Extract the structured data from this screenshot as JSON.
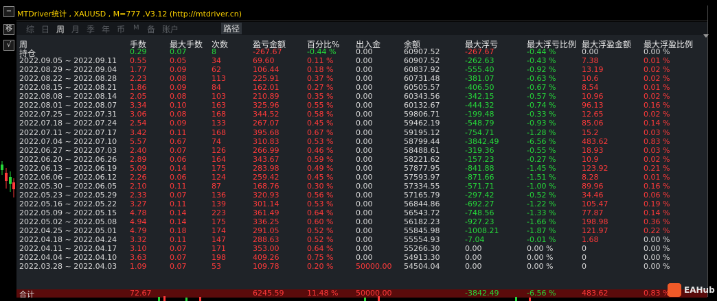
{
  "window": {
    "title": "MTDriver统计 , XAUUSD , M=777 ,V3.12 (http://mtdriver.cn)",
    "minimize_label": "−",
    "move_label": "移",
    "check_label": "√"
  },
  "tabs": [
    {
      "label": "综",
      "active": false
    },
    {
      "label": "日",
      "active": false
    },
    {
      "label": "周",
      "active": true
    },
    {
      "label": "月",
      "active": false
    },
    {
      "label": "季",
      "active": false
    },
    {
      "label": "年",
      "active": false
    },
    {
      "label": "币",
      "active": false
    },
    {
      "label": "M",
      "active": false
    },
    {
      "label": "备",
      "active": false
    },
    {
      "label": "账户",
      "active": false
    },
    {
      "label": "路径",
      "active": false
    }
  ],
  "table": {
    "headers": [
      "周",
      "手数",
      "最大手数",
      "次数",
      "盈亏金额",
      "百分比%",
      "出入金",
      "余额",
      "最大浮亏",
      "最大浮亏比例",
      "最大浮盈金额",
      "最大浮盈比例"
    ],
    "holding": [
      "持仓",
      "0.29",
      "0.07",
      "8",
      "-267.67",
      "-0.44 %",
      "0.00",
      "60907.52",
      "-267.67",
      "-0.44 %",
      "0.00",
      "0.00 %"
    ],
    "rows": [
      [
        "2022.09.05 ~ 2022.09.11",
        "0.55",
        "0.05",
        "34",
        "69.60",
        "0.11 %",
        "0.00",
        "60907.52",
        "-262.63",
        "-0.43 %",
        "7.38",
        "0.01 %"
      ],
      [
        "2022.08.29 ~ 2022.09.04",
        "1.77",
        "0.09",
        "62",
        "106.44",
        "0.18 %",
        "0.00",
        "60837.92",
        "-555.40",
        "-0.92 %",
        "13.19",
        "0.02 %"
      ],
      [
        "2022.08.22 ~ 2022.08.28",
        "2.23",
        "0.08",
        "113",
        "225.91",
        "0.37 %",
        "0.00",
        "60731.48",
        "-381.07",
        "-0.63 %",
        "10.6",
        "0.02 %"
      ],
      [
        "2022.08.15 ~ 2022.08.21",
        "1.86",
        "0.09",
        "84",
        "162.01",
        "0.27 %",
        "0.00",
        "60505.57",
        "-406.50",
        "-0.67 %",
        "8.54",
        "0.01 %"
      ],
      [
        "2022.08.08 ~ 2022.08.14",
        "2.05",
        "0.08",
        "103",
        "210.89",
        "0.35 %",
        "0.00",
        "60343.56",
        "-342.15",
        "-0.57 %",
        "10.96",
        "0.02 %"
      ],
      [
        "2022.08.01 ~ 2022.08.07",
        "3.34",
        "0.10",
        "163",
        "325.96",
        "0.55 %",
        "0.00",
        "60132.67",
        "-444.32",
        "-0.74 %",
        "96.13",
        "0.16 %"
      ],
      [
        "2022.07.25 ~ 2022.07.31",
        "3.06",
        "0.08",
        "168",
        "344.52",
        "0.58 %",
        "0.00",
        "59806.71",
        "-199.48",
        "-0.33 %",
        "12.65",
        "0.02 %"
      ],
      [
        "2022.07.18 ~ 2022.07.24",
        "2.54",
        "0.09",
        "133",
        "267.07",
        "0.45 %",
        "0.00",
        "59462.19",
        "-548.79",
        "-0.93 %",
        "85.06",
        "0.14 %"
      ],
      [
        "2022.07.11 ~ 2022.07.17",
        "3.42",
        "0.11",
        "168",
        "395.68",
        "0.67 %",
        "0.00",
        "59195.12",
        "-754.71",
        "-1.28 %",
        "15.2",
        "0.03 %"
      ],
      [
        "2022.07.04 ~ 2022.07.10",
        "5.57",
        "0.67",
        "74",
        "310.83",
        "0.53 %",
        "0.00",
        "58799.44",
        "-3842.49",
        "-6.56 %",
        "483.62",
        "0.83 %"
      ],
      [
        "2022.06.27 ~ 2022.07.03",
        "2.40",
        "0.07",
        "126",
        "266.99",
        "0.46 %",
        "0.00",
        "58488.61",
        "-319.36",
        "-0.55 %",
        "18.93",
        "0.03 %"
      ],
      [
        "2022.06.20 ~ 2022.06.26",
        "2.89",
        "0.06",
        "164",
        "343.67",
        "0.59 %",
        "0.00",
        "58221.62",
        "-157.23",
        "-0.27 %",
        "10.9",
        "0.02 %"
      ],
      [
        "2022.06.13 ~ 2022.06.19",
        "5.09",
        "0.14",
        "175",
        "283.98",
        "0.49 %",
        "0.00",
        "57877.95",
        "-841.88",
        "-1.45 %",
        "123.92",
        "0.21 %"
      ],
      [
        "2022.06.06 ~ 2022.06.12",
        "2.26",
        "0.06",
        "124",
        "259.42",
        "0.45 %",
        "0.00",
        "57593.97",
        "-871.66",
        "-1.51 %",
        "8.28",
        "0.01 %"
      ],
      [
        "2022.05.30 ~ 2022.06.05",
        "2.10",
        "0.11",
        "87",
        "168.76",
        "0.30 %",
        "0.00",
        "57334.55",
        "-571.71",
        "-1.00 %",
        "89.96",
        "0.16 %"
      ],
      [
        "2022.05.23 ~ 2022.05.29",
        "2.33",
        "0.07",
        "136",
        "320.93",
        "0.56 %",
        "0.00",
        "57165.79",
        "-297.42",
        "-0.52 %",
        "34.46",
        "0.06 %"
      ],
      [
        "2022.05.16 ~ 2022.05.22",
        "3.27",
        "0.11",
        "139",
        "301.14",
        "0.53 %",
        "0.00",
        "56844.86",
        "-692.27",
        "-1.22 %",
        "105.47",
        "0.19 %"
      ],
      [
        "2022.05.09 ~ 2022.05.15",
        "4.78",
        "0.14",
        "223",
        "361.49",
        "0.64 %",
        "0.00",
        "56543.72",
        "-748.56",
        "-1.33 %",
        "77.87",
        "0.14 %"
      ],
      [
        "2022.05.02 ~ 2022.05.08",
        "4.94",
        "0.14",
        "175",
        "336.25",
        "0.60 %",
        "0.00",
        "56182.23",
        "-927.23",
        "-1.66 %",
        "198.98",
        "0.36 %"
      ],
      [
        "2022.04.25 ~ 2022.05.01",
        "4.79",
        "0.18",
        "174",
        "291.05",
        "0.52 %",
        "0.00",
        "55845.98",
        "-1008.21",
        "-1.87 %",
        "121.97",
        "0.22 %"
      ],
      [
        "2022.04.18 ~ 2022.04.24",
        "3.32",
        "0.11",
        "147",
        "288.63",
        "0.52 %",
        "0.00",
        "55554.93",
        "-7.04",
        "-0.01 %",
        "1.68",
        "0.00 %"
      ],
      [
        "2022.04.11 ~ 2022.04.17",
        "3.10",
        "0.07",
        "171",
        "353.00",
        "0.64 %",
        "0.00",
        "55266.30",
        "0.00",
        "0.00 %",
        "0",
        "0.00 %"
      ],
      [
        "2022.04.04 ~ 2022.04.10",
        "3.63",
        "0.07",
        "198",
        "409.26",
        "0.75 %",
        "0.00",
        "54913.30",
        "0.00",
        "0.00 %",
        "0",
        "0.00 %"
      ],
      [
        "2022.03.28 ~ 2022.04.03",
        "1.09",
        "0.07",
        "53",
        "109.78",
        "0.20 %",
        "50000.00",
        "54504.04",
        "0.00",
        "0.00 %",
        "0",
        "0.00 %"
      ]
    ],
    "total": [
      "合计",
      "72.67",
      "",
      "",
      "6245.59",
      "11.48 %",
      "50000.00",
      "",
      "-3842.49",
      "-6.56 %",
      "483.62",
      "0.83 %"
    ]
  },
  "colors": {
    "red": "#ff3a3a",
    "green": "#26d93a",
    "white": "#d9d9d9",
    "title": "#ffd400"
  },
  "logo": {
    "text": "EAHub",
    "icon": "eahub-logo-icon"
  }
}
